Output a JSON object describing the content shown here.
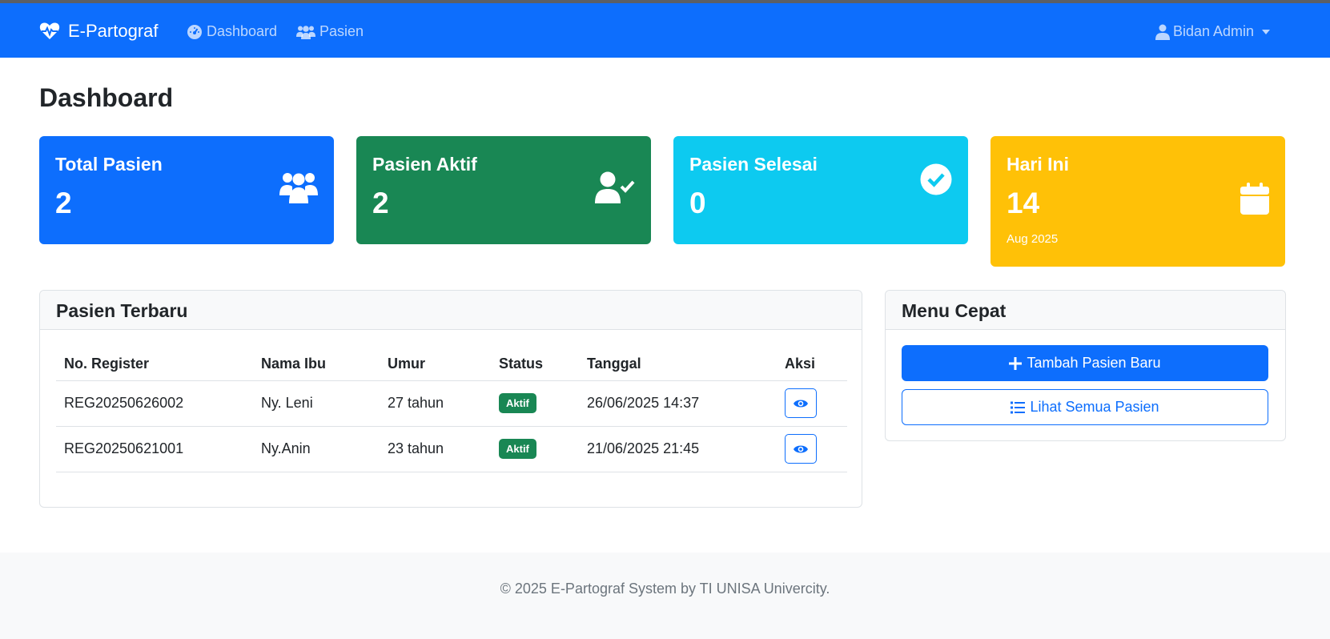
{
  "navbar": {
    "brand": "E-Partograf",
    "links": [
      {
        "label": "Dashboard",
        "icon": "tachometer-icon"
      },
      {
        "label": "Pasien",
        "icon": "users-icon"
      }
    ],
    "user": "Bidan Admin"
  },
  "page": {
    "title": "Dashboard"
  },
  "stats": [
    {
      "label": "Total Pasien",
      "value": "2",
      "icon": "users-icon",
      "color": "#0d6efd"
    },
    {
      "label": "Pasien Aktif",
      "value": "2",
      "icon": "user-check-icon",
      "color": "#198754"
    },
    {
      "label": "Pasien Selesai",
      "value": "0",
      "icon": "check-circle-icon",
      "color": "#0dcaf0"
    },
    {
      "label": "Hari Ini",
      "value": "14",
      "sub": "Aug 2025",
      "icon": "calendar-icon",
      "color": "#ffc107"
    }
  ],
  "recent": {
    "title": "Pasien Terbaru",
    "columns": [
      "No. Register",
      "Nama Ibu",
      "Umur",
      "Status",
      "Tanggal",
      "Aksi"
    ],
    "rows": [
      {
        "register": "REG20250626002",
        "name": "Ny. Leni",
        "age": "27 tahun",
        "status": "Aktif",
        "date": "26/06/2025 14:37"
      },
      {
        "register": "REG20250621001",
        "name": "Ny.Anin",
        "age": "23 tahun",
        "status": "Aktif",
        "date": "21/06/2025 21:45"
      }
    ]
  },
  "quick_menu": {
    "title": "Menu Cepat",
    "add_label": "Tambah Pasien Baru",
    "list_label": "Lihat Semua Pasien"
  },
  "footer": {
    "text": "© 2025 E-Partograf System by TI UNISA Univercity."
  }
}
